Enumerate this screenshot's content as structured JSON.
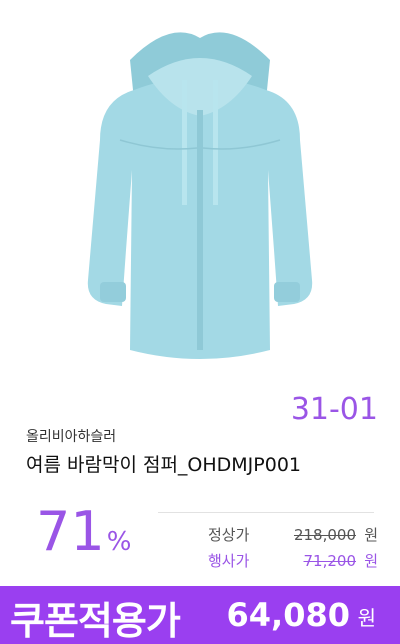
{
  "product": {
    "code": "31-01",
    "brand": "올리비아하슬러",
    "name": "여름 바람막이 점퍼_OHDMJP001",
    "image_icon": "jacket-image",
    "color": "#9fd7e3"
  },
  "pricing": {
    "discount_value": "71",
    "discount_unit": "%",
    "regular_label": "정상가",
    "regular_amount": "218,000",
    "regular_unit": "원",
    "event_label": "행사가",
    "event_amount": "71,200",
    "event_unit": "원"
  },
  "coupon": {
    "label": "쿠폰적용가",
    "amount": "64,080",
    "unit": "원",
    "bar_color": "#9a3ff0"
  },
  "accent_color": "#9a55e6"
}
